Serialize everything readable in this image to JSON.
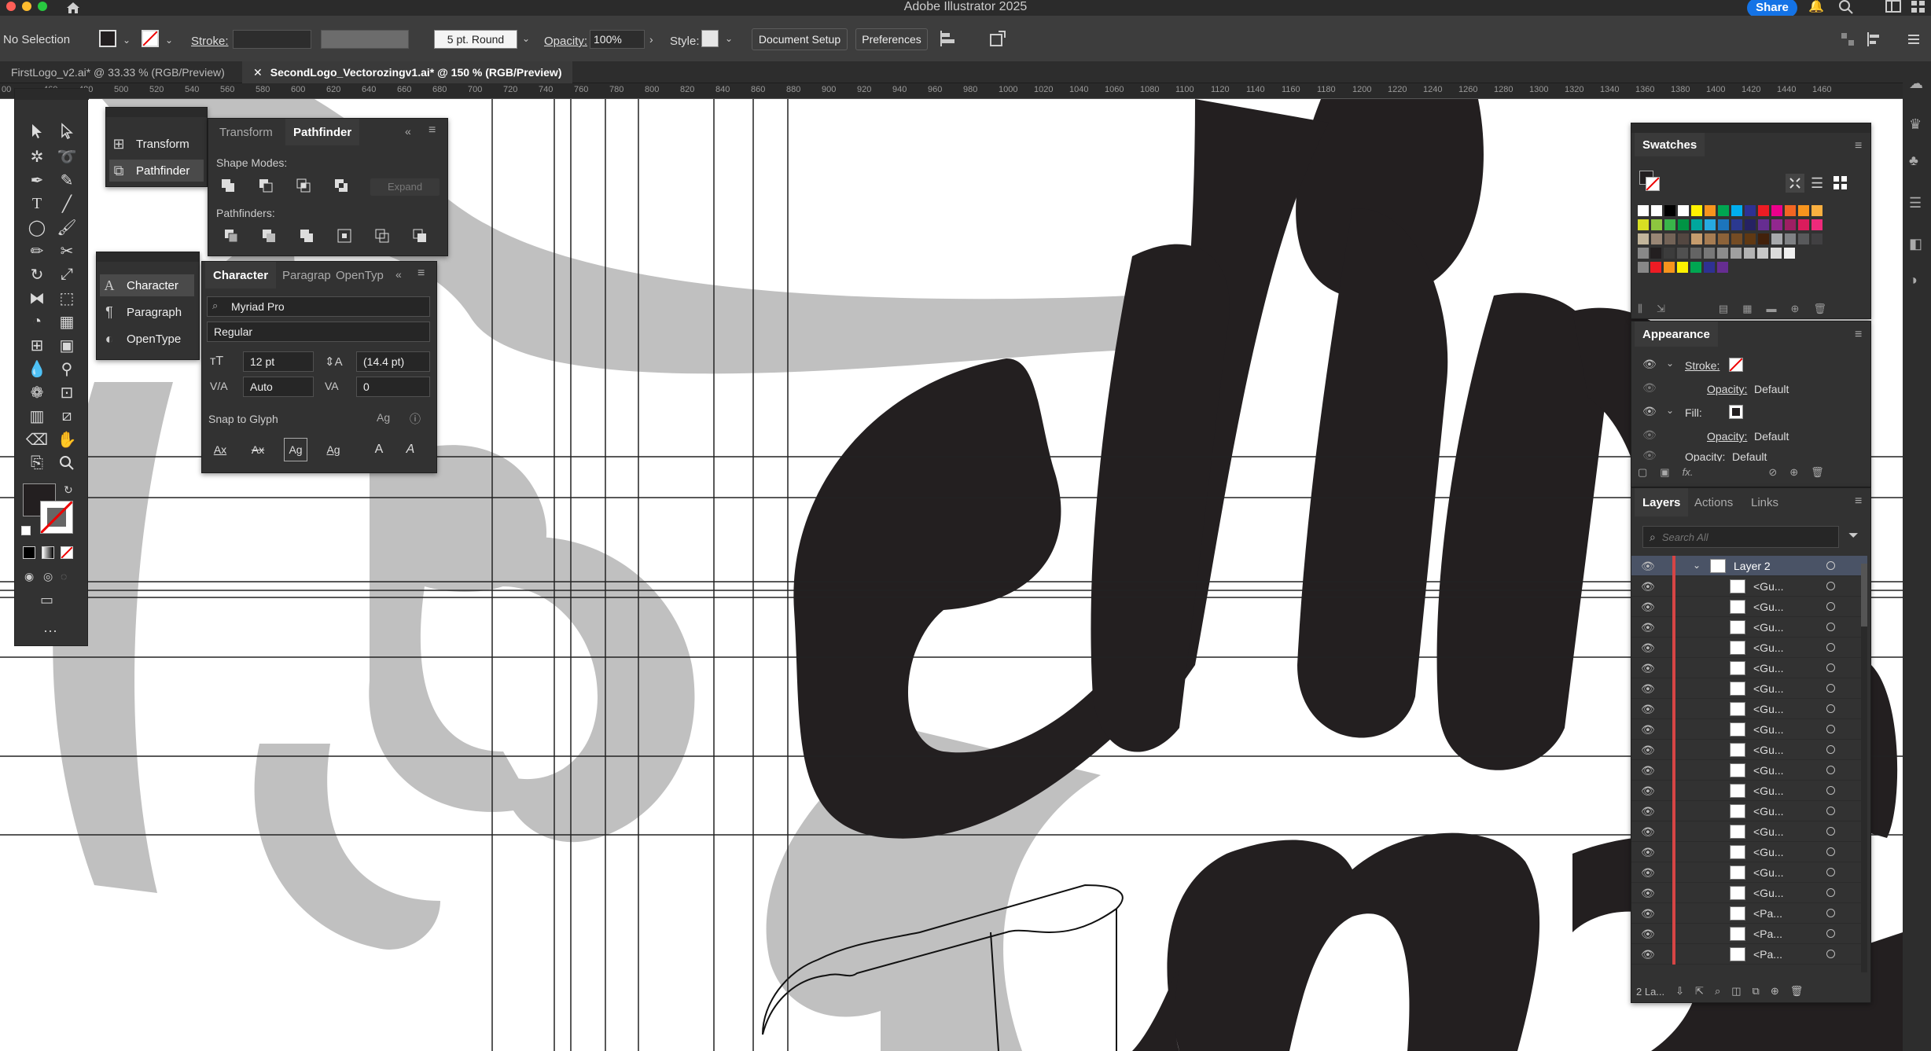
{
  "app": {
    "title": "Adobe Illustrator 2025",
    "share_label": "Share"
  },
  "control_bar": {
    "selection": "No Selection",
    "stroke_label": "Stroke:",
    "brush": "5 pt. Round",
    "opacity_label": "Opacity:",
    "opacity_value": "100%",
    "style_label": "Style:",
    "document_setup": "Document Setup",
    "preferences": "Preferences"
  },
  "tabs": [
    {
      "label": "FirstLogo_v2.ai* @ 33.33 % (RGB/Preview)"
    },
    {
      "label": "SecondLogo_Vectorozingv1.ai* @ 150 % (RGB/Preview)"
    }
  ],
  "ruler": {
    "ticks": [
      "00",
      "460",
      "480",
      "500",
      "520",
      "540",
      "560",
      "580",
      "600",
      "620",
      "640",
      "660",
      "680",
      "700",
      "720",
      "740",
      "760",
      "780",
      "800",
      "820",
      "840",
      "860",
      "880",
      "900",
      "920",
      "940",
      "960",
      "980",
      "1000",
      "1020",
      "1040",
      "1060",
      "1080",
      "1100",
      "1120",
      "1140",
      "1160",
      "1180",
      "1200",
      "1220",
      "1240",
      "1260",
      "1280",
      "1300",
      "1320",
      "1340",
      "1360",
      "1380",
      "1400",
      "1420",
      "1440",
      "1460"
    ]
  },
  "transform_panel": {
    "items": [
      {
        "label": "Transform"
      },
      {
        "label": "Pathfinder"
      }
    ]
  },
  "pathfinder_panel": {
    "tabs": [
      "Transform",
      "Pathfinder"
    ],
    "shape_modes_label": "Shape Modes:",
    "expand_label": "Expand",
    "pathfinders_label": "Pathfinders:"
  },
  "character_side": {
    "items": [
      {
        "label": "Character"
      },
      {
        "label": "Paragraph"
      },
      {
        "label": "OpenType"
      }
    ]
  },
  "character_panel": {
    "tabs": [
      "Character",
      "Paragrap",
      "OpenTyp"
    ],
    "font_family": "Myriad Pro",
    "font_style": "Regular",
    "font_size": "12 pt",
    "leading": "(14.4 pt)",
    "kerning": "Auto",
    "tracking": "0",
    "snap_label": "Snap to Glyph"
  },
  "swatches_panel": {
    "title": "Swatches",
    "rows": [
      [
        "#ffffff",
        "#ffffff",
        "#000000",
        "#ffffff",
        "#fff200",
        "#f7941d",
        "#00a651",
        "#00aeef",
        "#2e3192",
        "#ed1c24",
        "#ec008c",
        "#f26522",
        "#f7941d",
        "#fbb040"
      ],
      [
        "#d7df23",
        "#8dc63f",
        "#39b54a",
        "#009444",
        "#00a79d",
        "#27aae1",
        "#1c75bc",
        "#2b3990",
        "#262262",
        "#662d91",
        "#92278f",
        "#9e1f63",
        "#da1c5c",
        "#ee2a7b"
      ],
      [
        "#c2b59b",
        "#998675",
        "#736357",
        "#534741",
        "#c69c6d",
        "#a67c52",
        "#8c6239",
        "#754c24",
        "#603913",
        "#42210b",
        "#a7a9ac",
        "#808285",
        "#58595b",
        "#414042"
      ],
      [
        "#231f20",
        "#3c3c3c",
        "#505050",
        "#646464",
        "#787878",
        "#8c8c8c",
        "#a0a0a0",
        "#b4b4b4",
        "#c8c8c8",
        "#dcdcdc",
        "#f0f0f0"
      ],
      [
        "#ed1c24",
        "#f7941d",
        "#fff200",
        "#00a651",
        "#2e3192",
        "#662d91"
      ]
    ]
  },
  "appearance_panel": {
    "title": "Appearance",
    "rows": [
      {
        "label": "Stroke:"
      },
      {
        "label": "Opacity:",
        "value": "Default"
      },
      {
        "label": "Fill:"
      },
      {
        "label": "Opacity:",
        "value": "Default"
      },
      {
        "label": "Opacity:",
        "value": "Default"
      }
    ]
  },
  "layers_panel": {
    "tabs": [
      "Layers",
      "Actions",
      "Links"
    ],
    "search_placeholder": "Search All",
    "layer_name": "Layer 2",
    "items": [
      "<Gu...",
      "<Gu...",
      "<Gu...",
      "<Gu...",
      "<Gu...",
      "<Gu...",
      "<Gu...",
      "<Gu...",
      "<Gu...",
      "<Gu...",
      "<Gu...",
      "<Gu...",
      "<Gu...",
      "<Gu...",
      "<Gu...",
      "<Gu...",
      "<Pa...",
      "<Pa...",
      "<Pa..."
    ],
    "footer_count": "2 La..."
  },
  "colors": {
    "accent": "#1473e6",
    "canvas": "#ffffff",
    "ui_dark": "#323232",
    "artwork_black": "#231f20",
    "artwork_gray": "#c0c0c0",
    "layer_color": "#d64545"
  }
}
